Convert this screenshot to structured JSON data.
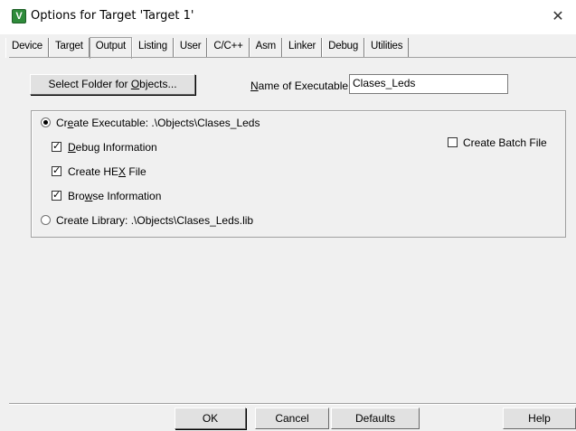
{
  "window": {
    "title": "Options for Target 'Target 1'",
    "close_glyph": "✕",
    "app_icon_glyph": "V"
  },
  "tabs": [
    {
      "label": "Device",
      "active": false
    },
    {
      "label": "Target",
      "active": false
    },
    {
      "label": "Output",
      "active": true
    },
    {
      "label": "Listing",
      "active": false
    },
    {
      "label": "User",
      "active": false
    },
    {
      "label": "C/C++",
      "active": false
    },
    {
      "label": "Asm",
      "active": false
    },
    {
      "label": "Linker",
      "active": false
    },
    {
      "label": "Debug",
      "active": false
    },
    {
      "label": "Utilities",
      "active": false
    }
  ],
  "output": {
    "select_folder_button": {
      "pre": "Select Folder for ",
      "mnemonic": "O",
      "post": "bjects..."
    },
    "name_label": {
      "mnemonic": "N",
      "post": "ame of Executable:"
    },
    "name_value": "Clases_Leds",
    "create_executable": {
      "pre": "Cr",
      "mnemonic": "e",
      "post": "ate Executable:  .\\Objects\\Clases_Leds",
      "selected": true
    },
    "debug_info": {
      "mnemonic": "D",
      "post": "ebug Information",
      "checked": true
    },
    "create_hex": {
      "pre": "Create HE",
      "mnemonic": "X",
      "post": " File",
      "checked": true
    },
    "browse_info": {
      "pre": "Bro",
      "mnemonic": "w",
      "post": "se Information",
      "checked": true
    },
    "create_batch": {
      "label": "Create Batch File",
      "checked": false
    },
    "create_library": {
      "label": "Create Library:  .\\Objects\\Clases_Leds.lib",
      "selected": false
    }
  },
  "footer": {
    "ok": "OK",
    "cancel": "Cancel",
    "defaults": "Defaults",
    "help": "Help"
  },
  "check_glyph": "✓"
}
